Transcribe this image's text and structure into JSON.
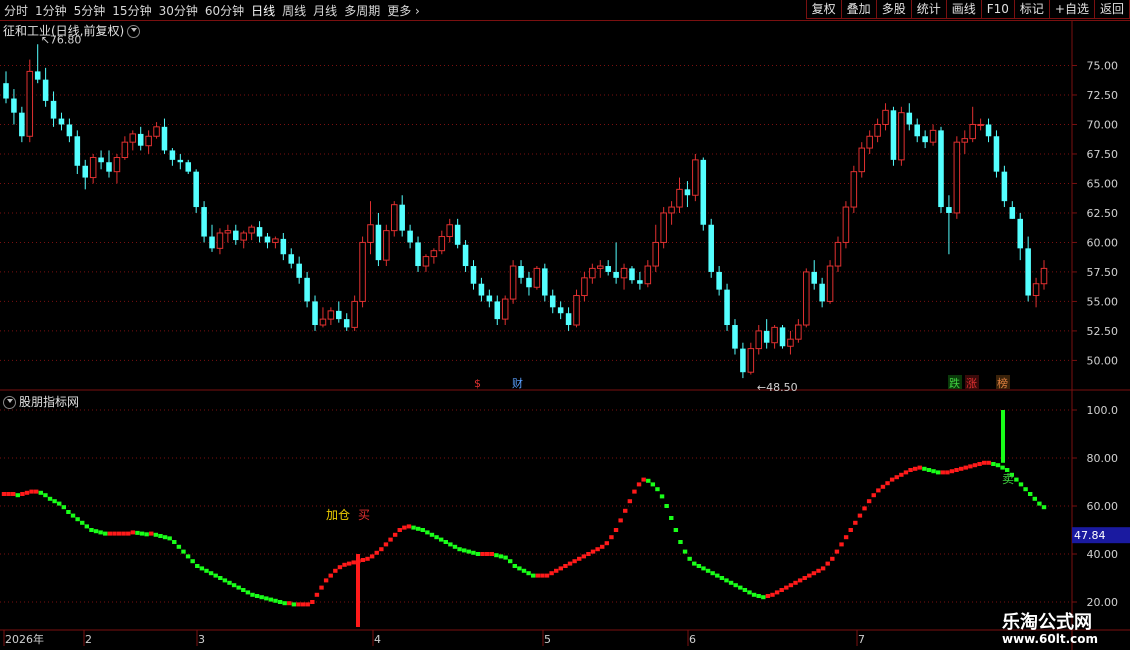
{
  "toolbar": {
    "periods": [
      "分时",
      "1分钟",
      "5分钟",
      "15分钟",
      "30分钟",
      "60分钟",
      "日线",
      "周线",
      "月线",
      "多周期",
      "更多"
    ],
    "active_period": "日线",
    "buttons": [
      "复权",
      "叠加",
      "多股",
      "统计",
      "画线",
      "F10",
      "标记",
      "+自选",
      "返回"
    ]
  },
  "main_panel": {
    "title": "征和工业(日线,前复权)",
    "high_label": "76.80",
    "low_label": "48.50",
    "y_ticks": [
      "75.00",
      "72.50",
      "70.00",
      "67.50",
      "65.00",
      "62.50",
      "60.00",
      "57.50",
      "55.00",
      "52.50",
      "50.00"
    ],
    "event_tags": [
      {
        "text": "$",
        "color": "#e03030"
      },
      {
        "text": "财",
        "color": "#5aa0ff"
      },
      {
        "text": "跌",
        "color": "#40d040"
      },
      {
        "text": "涨",
        "color": "#e03030"
      },
      {
        "text": "榜",
        "color": "#e08040"
      }
    ]
  },
  "indicator_panel": {
    "title": "股朋指标网",
    "y_ticks": [
      "100.0",
      "80.00",
      "60.00",
      "40.00",
      "20.00"
    ],
    "current_value": "47.84",
    "signals": {
      "add": "加仓",
      "buy": "买",
      "sell": "卖"
    }
  },
  "date_axis": {
    "labels": [
      "2026年",
      "2",
      "3",
      "4",
      "5",
      "6",
      "7"
    ]
  },
  "watermark": {
    "title": "乐淘公式网",
    "url": "www.60lt.com"
  },
  "colors": {
    "up": "#e03030",
    "down": "#54ffff",
    "indicator_up": "#ff1a1a",
    "indicator_down": "#19ff19",
    "grid": "#7a1010"
  },
  "chart_data": [
    {
      "type": "candlestick",
      "title": "征和工业(日线,前复权)",
      "ylim": [
        48,
        77.5
      ],
      "annotations": [
        {
          "text": "76.80",
          "type": "high"
        },
        {
          "text": "48.50",
          "type": "low"
        }
      ],
      "ohlc": [
        [
          73.5,
          74.5,
          71.8,
          72.2
        ],
        [
          72.2,
          73.0,
          70.0,
          71.0
        ],
        [
          71.0,
          71.5,
          68.5,
          69.0
        ],
        [
          69.0,
          75.5,
          68.5,
          74.5
        ],
        [
          74.5,
          76.8,
          73.5,
          73.8
        ],
        [
          73.8,
          74.8,
          71.5,
          72.0
        ],
        [
          72.0,
          72.8,
          69.8,
          70.5
        ],
        [
          70.5,
          71.0,
          69.5,
          70.0
        ],
        [
          70.0,
          70.5,
          68.5,
          69.0
        ],
        [
          69.0,
          69.5,
          65.8,
          66.5
        ],
        [
          66.5,
          67.0,
          64.5,
          65.5
        ],
        [
          65.5,
          67.5,
          65.0,
          67.2
        ],
        [
          67.2,
          67.8,
          66.2,
          66.8
        ],
        [
          66.8,
          67.8,
          65.5,
          66.0
        ],
        [
          66.0,
          67.5,
          65.0,
          67.2
        ],
        [
          67.2,
          69.0,
          67.0,
          68.5
        ],
        [
          68.5,
          69.5,
          67.8,
          69.2
        ],
        [
          69.2,
          69.8,
          67.8,
          68.2
        ],
        [
          68.2,
          69.5,
          67.5,
          69.0
        ],
        [
          69.0,
          70.2,
          68.8,
          69.8
        ],
        [
          69.8,
          70.5,
          67.5,
          67.8
        ],
        [
          67.8,
          68.0,
          66.5,
          67.0
        ],
        [
          67.0,
          67.5,
          66.2,
          66.8
        ],
        [
          66.8,
          67.0,
          65.8,
          66.0
        ],
        [
          66.0,
          66.2,
          62.5,
          63.0
        ],
        [
          63.0,
          63.5,
          60.0,
          60.5
        ],
        [
          60.5,
          61.5,
          59.2,
          59.5
        ],
        [
          59.5,
          61.2,
          59.0,
          60.8
        ],
        [
          60.8,
          61.5,
          60.0,
          61.0
        ],
        [
          61.0,
          61.5,
          59.8,
          60.2
        ],
        [
          60.2,
          61.0,
          59.5,
          60.8
        ],
        [
          60.8,
          61.5,
          60.2,
          61.3
        ],
        [
          61.3,
          61.8,
          60.0,
          60.5
        ],
        [
          60.5,
          60.8,
          59.5,
          60.0
        ],
        [
          60.0,
          60.5,
          59.5,
          60.3
        ],
        [
          60.3,
          60.8,
          58.5,
          59.0
        ],
        [
          59.0,
          59.5,
          57.8,
          58.2
        ],
        [
          58.2,
          58.8,
          56.5,
          57.0
        ],
        [
          57.0,
          57.5,
          54.5,
          55.0
        ],
        [
          55.0,
          55.5,
          52.5,
          53.0
        ],
        [
          53.0,
          54.5,
          52.8,
          53.5
        ],
        [
          53.5,
          54.5,
          53.0,
          54.2
        ],
        [
          54.2,
          55.0,
          53.2,
          53.5
        ],
        [
          53.5,
          54.0,
          52.5,
          52.8
        ],
        [
          52.8,
          55.5,
          52.5,
          55.0
        ],
        [
          55.0,
          60.5,
          54.5,
          60.0
        ],
        [
          60.0,
          63.5,
          59.0,
          61.5
        ],
        [
          61.5,
          62.5,
          58.0,
          58.5
        ],
        [
          58.5,
          61.5,
          58.0,
          61.0
        ],
        [
          61.0,
          63.5,
          60.5,
          63.2
        ],
        [
          63.2,
          64.0,
          60.5,
          61.0
        ],
        [
          61.0,
          61.5,
          59.5,
          60.0
        ],
        [
          60.0,
          60.5,
          57.5,
          58.0
        ],
        [
          58.0,
          59.0,
          57.5,
          58.8
        ],
        [
          58.8,
          59.5,
          58.2,
          59.3
        ],
        [
          59.3,
          61.0,
          59.0,
          60.5
        ],
        [
          60.5,
          62.0,
          60.0,
          61.5
        ],
        [
          61.5,
          62.0,
          59.5,
          59.8
        ],
        [
          59.8,
          60.2,
          57.5,
          58.0
        ],
        [
          58.0,
          58.5,
          56.0,
          56.5
        ],
        [
          56.5,
          57.0,
          55.0,
          55.5
        ],
        [
          55.5,
          56.0,
          54.5,
          55.0
        ],
        [
          55.0,
          55.5,
          53.0,
          53.5
        ],
        [
          53.5,
          55.5,
          53.0,
          55.2
        ],
        [
          55.2,
          58.5,
          54.8,
          58.0
        ],
        [
          58.0,
          58.5,
          56.5,
          57.0
        ],
        [
          57.0,
          57.5,
          55.5,
          56.2
        ],
        [
          56.2,
          58.0,
          56.0,
          57.8
        ],
        [
          57.8,
          58.2,
          55.0,
          55.5
        ],
        [
          55.5,
          56.0,
          54.0,
          54.5
        ],
        [
          54.5,
          55.0,
          53.5,
          54.0
        ],
        [
          54.0,
          54.5,
          52.5,
          53.0
        ],
        [
          53.0,
          56.0,
          52.8,
          55.5
        ],
        [
          55.5,
          57.5,
          55.0,
          57.0
        ],
        [
          57.0,
          58.2,
          56.5,
          57.8
        ],
        [
          57.8,
          58.5,
          57.0,
          58.0
        ],
        [
          58.0,
          58.5,
          57.2,
          57.5
        ],
        [
          57.5,
          60.0,
          56.5,
          57.0
        ],
        [
          57.0,
          58.2,
          56.0,
          57.8
        ],
        [
          57.8,
          58.0,
          56.5,
          56.8
        ],
        [
          56.8,
          57.5,
          56.0,
          56.5
        ],
        [
          56.5,
          58.5,
          56.2,
          58.0
        ],
        [
          58.0,
          61.5,
          57.5,
          60.0
        ],
        [
          60.0,
          63.0,
          59.5,
          62.5
        ],
        [
          62.5,
          63.5,
          61.5,
          63.0
        ],
        [
          63.0,
          65.5,
          62.5,
          64.5
        ],
        [
          64.5,
          65.2,
          63.0,
          64.0
        ],
        [
          64.0,
          67.5,
          63.5,
          67.0
        ],
        [
          67.0,
          67.2,
          61.0,
          61.5
        ],
        [
          61.5,
          62.0,
          57.0,
          57.5
        ],
        [
          57.5,
          58.0,
          55.5,
          56.0
        ],
        [
          56.0,
          56.5,
          52.5,
          53.0
        ],
        [
          53.0,
          53.5,
          50.5,
          51.0
        ],
        [
          51.0,
          51.5,
          48.5,
          49.0
        ],
        [
          49.0,
          51.5,
          48.8,
          51.0
        ],
        [
          51.0,
          53.0,
          50.5,
          52.5
        ],
        [
          52.5,
          53.5,
          51.0,
          51.5
        ],
        [
          51.5,
          53.0,
          51.0,
          52.8
        ],
        [
          52.8,
          53.0,
          51.0,
          51.2
        ],
        [
          51.2,
          52.5,
          50.5,
          51.8
        ],
        [
          51.8,
          53.5,
          51.5,
          53.0
        ],
        [
          53.0,
          57.8,
          52.8,
          57.5
        ],
        [
          57.5,
          58.5,
          56.0,
          56.5
        ],
        [
          56.5,
          57.0,
          54.5,
          55.0
        ],
        [
          55.0,
          58.5,
          54.8,
          58.0
        ],
        [
          58.0,
          60.5,
          57.5,
          60.0
        ],
        [
          60.0,
          63.5,
          59.5,
          63.0
        ],
        [
          63.0,
          66.5,
          62.5,
          66.0
        ],
        [
          66.0,
          68.5,
          65.5,
          68.0
        ],
        [
          68.0,
          69.5,
          67.5,
          69.0
        ],
        [
          69.0,
          70.5,
          68.5,
          70.0
        ],
        [
          70.0,
          71.8,
          69.5,
          71.2
        ],
        [
          71.2,
          71.5,
          66.5,
          67.0
        ],
        [
          67.0,
          71.5,
          66.5,
          71.0
        ],
        [
          71.0,
          71.8,
          69.5,
          70.0
        ],
        [
          70.0,
          70.5,
          68.5,
          69.0
        ],
        [
          69.0,
          69.5,
          68.0,
          68.5
        ],
        [
          68.5,
          70.0,
          68.2,
          69.5
        ],
        [
          69.5,
          69.8,
          62.5,
          63.0
        ],
        [
          63.0,
          64.0,
          59.0,
          62.5
        ],
        [
          62.5,
          69.0,
          62.0,
          68.5
        ],
        [
          68.5,
          69.5,
          67.5,
          68.8
        ],
        [
          68.8,
          71.5,
          68.5,
          70.0
        ],
        [
          70.0,
          70.5,
          69.5,
          70.0
        ],
        [
          70.0,
          70.5,
          68.5,
          69.0
        ],
        [
          69.0,
          69.5,
          65.5,
          66.0
        ],
        [
          66.0,
          66.5,
          63.0,
          63.5
        ],
        [
          63.0,
          63.5,
          62.0,
          62.0
        ],
        [
          62.0,
          62.5,
          58.5,
          59.5
        ],
        [
          59.5,
          60.5,
          55.0,
          55.5
        ],
        [
          55.5,
          57.0,
          54.5,
          56.5
        ],
        [
          56.5,
          58.5,
          56.0,
          57.8
        ]
      ]
    },
    {
      "type": "bar",
      "title": "股朋指标网",
      "ylim": [
        10,
        105
      ],
      "current_value": 47.84,
      "values": [
        65,
        65,
        65,
        64.5,
        65,
        65.5,
        66,
        66,
        65.5,
        64.5,
        63,
        62,
        61,
        59.5,
        57.5,
        56,
        54.5,
        53,
        51.5,
        50,
        49.5,
        49,
        48.5,
        48.5,
        48.5,
        48.5,
        48.5,
        48.5,
        49,
        48.8,
        48.5,
        48.2,
        48.5,
        48,
        47.5,
        47,
        46.5,
        45,
        43,
        41,
        39,
        37,
        35,
        34,
        33,
        32,
        31,
        30,
        29,
        28,
        27,
        26,
        25,
        24,
        23,
        22.5,
        22,
        21.5,
        21,
        20.5,
        20,
        19.5,
        19.5,
        19,
        19,
        19,
        19,
        20,
        23,
        26,
        29,
        31,
        33,
        34.5,
        35.5,
        36,
        36.5,
        37,
        37.5,
        38,
        39,
        40.5,
        42,
        44,
        46,
        48,
        50,
        51,
        51.5,
        51,
        50.5,
        50,
        49,
        48,
        47,
        46,
        45,
        44,
        43,
        42,
        41.5,
        41,
        40.5,
        40,
        40,
        40,
        40,
        39.5,
        39,
        38.5,
        37,
        35,
        34,
        33,
        32,
        31,
        31,
        31,
        31,
        32,
        33,
        34,
        35,
        36,
        37,
        38,
        39,
        40,
        41,
        42,
        43,
        44.5,
        47,
        50,
        54,
        58,
        62,
        66,
        69,
        71,
        70.5,
        69,
        67,
        64,
        60,
        55,
        50,
        45,
        41,
        38,
        36,
        35,
        34,
        33,
        32,
        31,
        30,
        29,
        28,
        27,
        26,
        25,
        24,
        23,
        22.5,
        22,
        22.5,
        23,
        24,
        25,
        26,
        27,
        28,
        29,
        30,
        31,
        32,
        33,
        34,
        36,
        38,
        41,
        44,
        47,
        50,
        53,
        56,
        59,
        62,
        64.5,
        66.5,
        68,
        69.5,
        71,
        72,
        73,
        74,
        75,
        75.5,
        76,
        75.5,
        75,
        74.5,
        74,
        74,
        74,
        74.5,
        75,
        75.5,
        76,
        76.5,
        77,
        77.5,
        78,
        78,
        77.5,
        77,
        76,
        75,
        73,
        71,
        69,
        67,
        65,
        63,
        61,
        59.5
      ],
      "signals": [
        {
          "text": "加仓",
          "color": "#f0d000"
        },
        {
          "text": "买",
          "color": "#e03030"
        },
        {
          "text": "卖",
          "color": "#40d040"
        }
      ]
    }
  ]
}
